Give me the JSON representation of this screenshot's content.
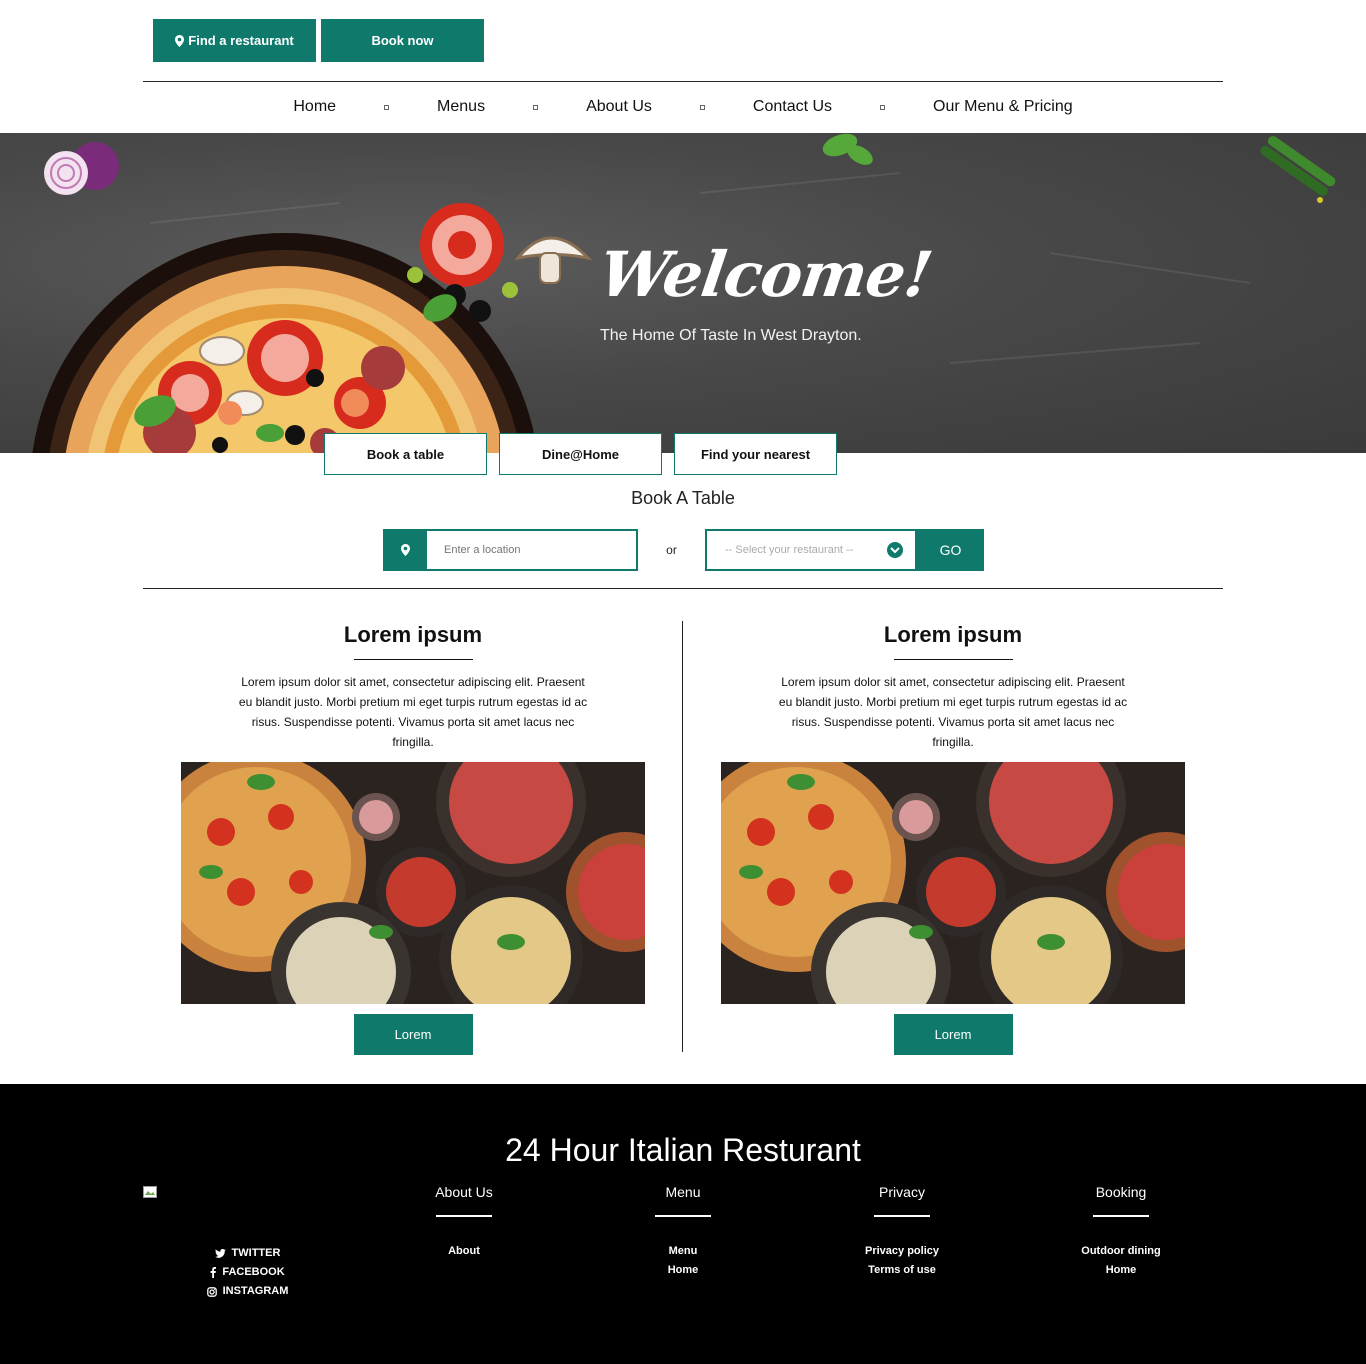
{
  "colors": {
    "accent": "#0f7a6c",
    "footer_bg": "#000000",
    "hero_bg": "#474747"
  },
  "topbar": {
    "find_label": "Find a restaurant",
    "book_label": "Book now",
    "find_icon": "map-marker-icon"
  },
  "nav": {
    "items": [
      "Home",
      "Menus",
      "About Us",
      "Contact Us",
      "Our Menu & Pricing"
    ]
  },
  "hero": {
    "welcome": "Welcome!",
    "tagline": "The Home Of Taste In West Drayton."
  },
  "tabs": [
    "Book a table",
    "Dine@Home",
    "Find your nearest"
  ],
  "booking": {
    "title": "Book A Table",
    "location_placeholder": "Enter a location",
    "or": "or",
    "select_placeholder": "-- Select your restaurant --",
    "go": "GO"
  },
  "cards": [
    {
      "title": "Lorem ipsum",
      "text": "Lorem ipsum dolor sit amet, consectetur adipiscing elit. Praesent eu blandit justo. Morbi pretium mi eget turpis rutrum egestas id ac risus. Suspendisse potenti. Vivamus porta sit amet lacus nec fringilla.",
      "button": "Lorem"
    },
    {
      "title": "Lorem ipsum",
      "text": "Lorem ipsum dolor sit amet, consectetur adipiscing elit. Praesent eu blandit justo. Morbi pretium mi eget turpis rutrum egestas id ac risus. Suspendisse potenti. Vivamus porta sit amet lacus nec fringilla.",
      "button": "Lorem"
    }
  ],
  "footer": {
    "title": "24 Hour Italian Resturant",
    "social": [
      {
        "icon": "twitter-icon",
        "label": "TWITTER"
      },
      {
        "icon": "facebook-icon",
        "label": "FACEBOOK"
      },
      {
        "icon": "instagram-icon",
        "label": "INSTAGRAM"
      }
    ],
    "columns": [
      {
        "heading": "About Us",
        "links": [
          "About"
        ]
      },
      {
        "heading": "Menu",
        "links": [
          "Menu",
          "Home"
        ]
      },
      {
        "heading": "Privacy",
        "links": [
          "Privacy policy",
          "Terms of use"
        ]
      },
      {
        "heading": "Booking",
        "links": [
          "Outdoor dining",
          "Home"
        ]
      }
    ]
  }
}
